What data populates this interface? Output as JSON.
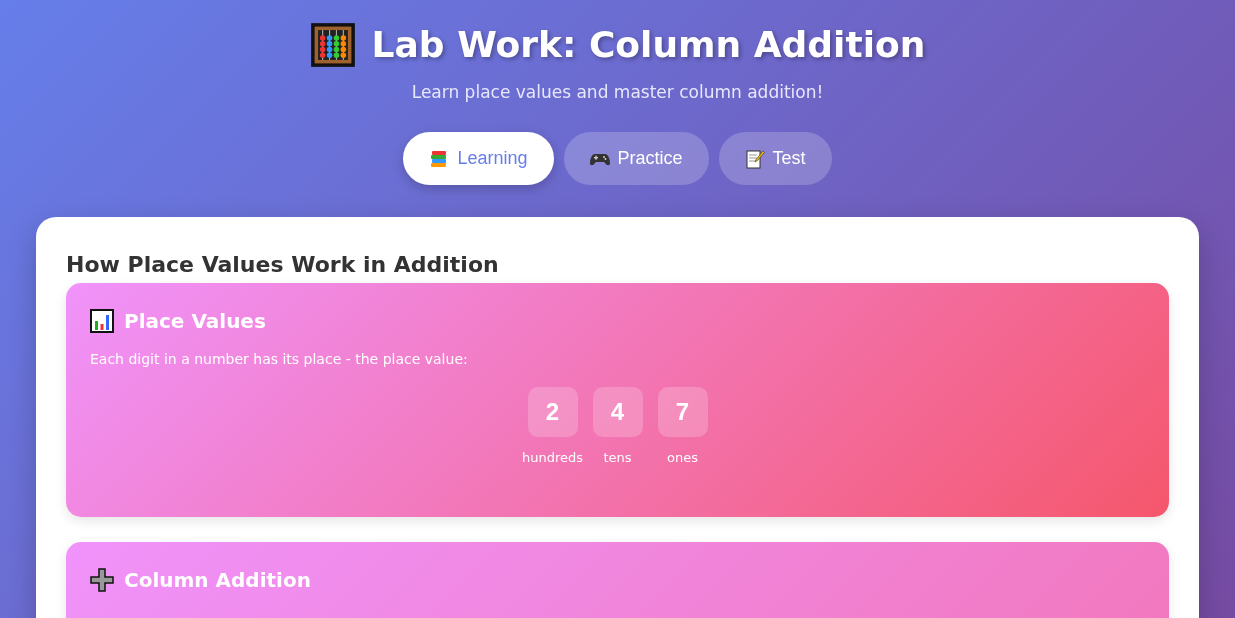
{
  "header": {
    "title": "Lab Work: Column Addition",
    "subtitle": "Learn place values and master column addition!"
  },
  "tabs": [
    {
      "label": "Learning",
      "selected": true
    },
    {
      "label": "Practice",
      "selected": false
    },
    {
      "label": "Test",
      "selected": false
    }
  ],
  "content": {
    "heading": "How Place Values Work in Addition",
    "sections": [
      {
        "title": "Place Values",
        "text": "Each digit in a number has its place - the place value:",
        "digits": [
          {
            "digit": "2",
            "place": "hundreds"
          },
          {
            "digit": "4",
            "place": "tens"
          },
          {
            "digit": "7",
            "place": "ones"
          }
        ]
      },
      {
        "title": "Column Addition"
      }
    ]
  }
}
